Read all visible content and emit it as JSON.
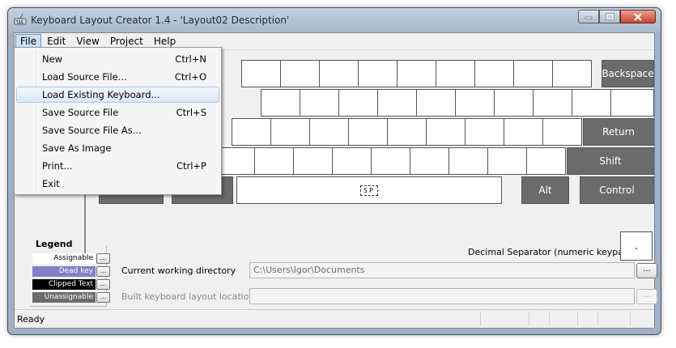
{
  "window": {
    "title": "Keyboard Layout Creator 1.4 - 'Layout02 Description'",
    "icon": "keyboard-app-icon"
  },
  "menubar": [
    "File",
    "Edit",
    "View",
    "Project",
    "Help"
  ],
  "file_menu": [
    {
      "label": "New",
      "shortcut": "Ctrl+N"
    },
    {
      "label": "Load Source File...",
      "shortcut": "Ctrl+O"
    },
    {
      "label": "Load Existing Keyboard...",
      "shortcut": ""
    },
    {
      "label": "Save Source File",
      "shortcut": "Ctrl+S"
    },
    {
      "label": "Save Source File As...",
      "shortcut": ""
    },
    {
      "label": "Save As Image",
      "shortcut": ""
    },
    {
      "label": "Print...",
      "shortcut": "Ctrl+P"
    },
    {
      "label": "Exit",
      "shortcut": ""
    }
  ],
  "keys": {
    "backspace": "Backspace",
    "return": "Return",
    "shift": "Shift",
    "alt": "Alt",
    "control": "Control",
    "space_marker": "SP",
    "decimal": "."
  },
  "decimal_separator_label": "Decimal Separator (numeric keypad)",
  "legend": {
    "title": "Legend",
    "items": [
      {
        "label": "Assignable",
        "color": "#ffffff",
        "text_color": "#000000"
      },
      {
        "label": "Dead key",
        "color": "#8080c8",
        "text_color": "#ffffff"
      },
      {
        "label": "Clipped Text",
        "color": "#000000",
        "text_color": "#ffffff"
      },
      {
        "label": "Unassignable",
        "color": "#6b6b6b",
        "text_color": "#ffffff"
      }
    ],
    "button_label": "..."
  },
  "working_directory": {
    "label": "Current working directory",
    "value": "C:\\Users\\Igor\\Documents",
    "browse": "..."
  },
  "build_location": {
    "label": "Built keyboard layout location",
    "value": "",
    "browse": "..."
  },
  "status": "Ready"
}
